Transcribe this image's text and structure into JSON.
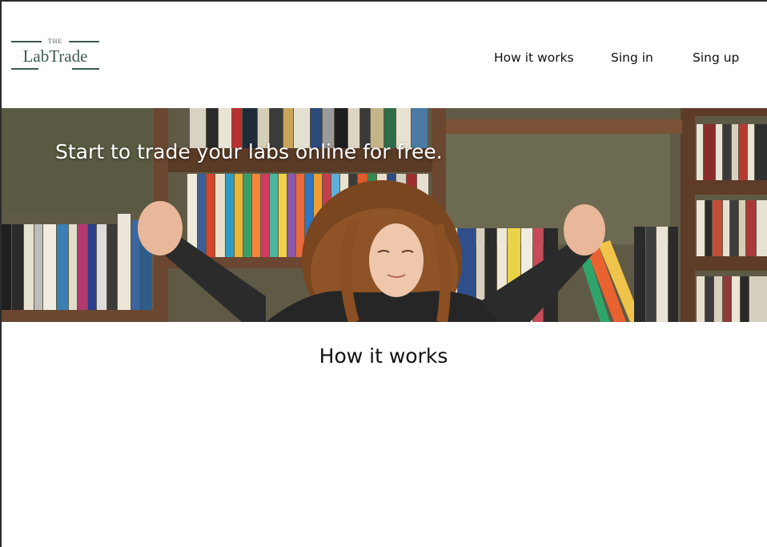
{
  "header": {
    "logo": {
      "small": "THE",
      "name": "LabTrade"
    },
    "nav": {
      "how_it_works": "How it works",
      "sign_in": "Sing in",
      "sign_up": "Sing up"
    }
  },
  "hero": {
    "headline": "Start to trade your labs online for free.",
    "image": "girl-stretching-in-front-of-bookshelf"
  },
  "section": {
    "title": "How it works"
  },
  "colors": {
    "brand": "#3f5a55",
    "background": "#ffffff",
    "text": "#111111"
  }
}
